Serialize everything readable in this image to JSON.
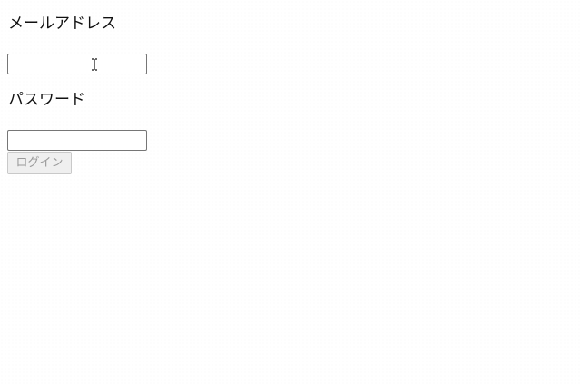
{
  "form": {
    "email_label": "メールアドレス",
    "email_value": "",
    "password_label": "パスワード",
    "password_value": "",
    "login_button_label": "ログイン",
    "login_button_disabled": true
  }
}
